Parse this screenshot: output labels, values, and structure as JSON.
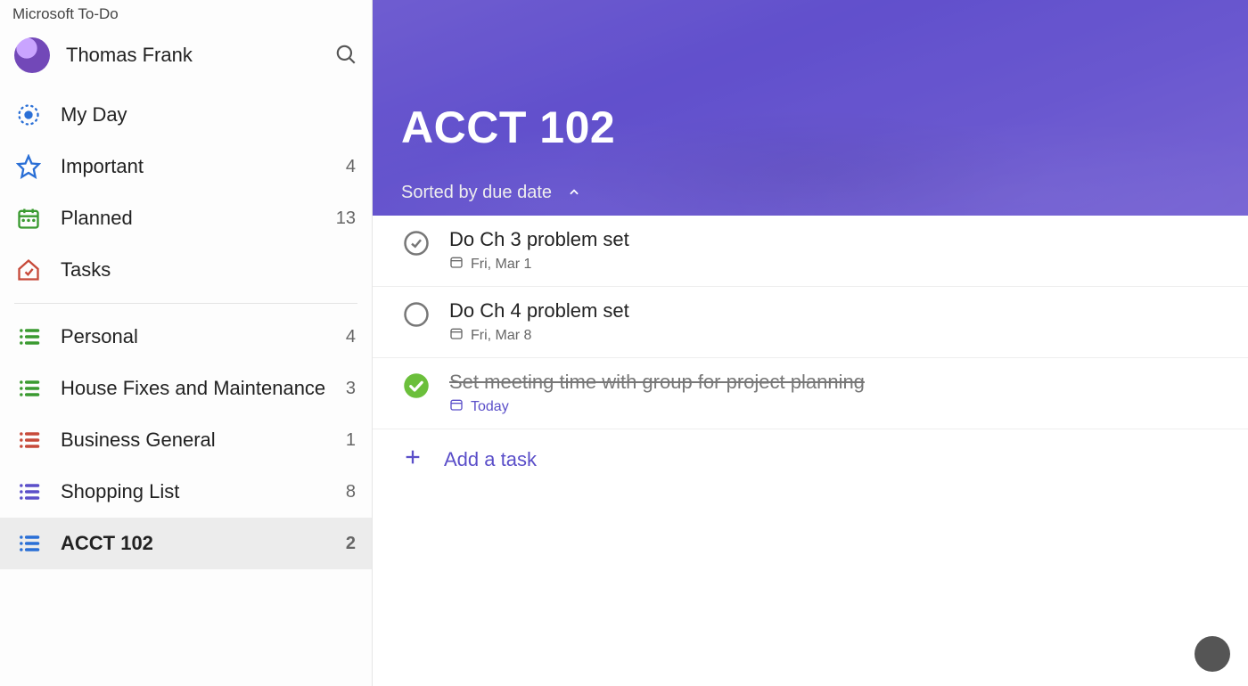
{
  "app": {
    "title": "Microsoft To-Do"
  },
  "profile": {
    "name": "Thomas Frank"
  },
  "colors": {
    "accent": "#5b4fc9",
    "green": "#3a9a30",
    "red": "#c74a3a",
    "blue": "#2a6fd6",
    "sun": "#2a6fd6"
  },
  "sidebar": {
    "smart_lists": [
      {
        "id": "myday",
        "label": "My Day",
        "icon": "sun-icon",
        "color": "#2a6fd6",
        "count": null
      },
      {
        "id": "important",
        "label": "Important",
        "icon": "star-icon",
        "color": "#2a6fd6",
        "count": 4
      },
      {
        "id": "planned",
        "label": "Planned",
        "icon": "calendar-icon",
        "color": "#3a9a30",
        "count": 13
      },
      {
        "id": "tasks",
        "label": "Tasks",
        "icon": "home-check-icon",
        "color": "#c74a3a",
        "count": null
      }
    ],
    "custom_lists": [
      {
        "id": "personal",
        "label": "Personal",
        "color": "#3a9a30",
        "count": 4
      },
      {
        "id": "house",
        "label": "House Fixes and Maintenance",
        "color": "#3a9a30",
        "count": 3
      },
      {
        "id": "business",
        "label": "Business General",
        "color": "#c74a3a",
        "count": 1
      },
      {
        "id": "shopping",
        "label": "Shopping List",
        "color": "#5b4fc9",
        "count": 8
      },
      {
        "id": "acct102",
        "label": "ACCT 102",
        "color": "#2a6fd6",
        "count": 2,
        "active": true
      }
    ]
  },
  "main": {
    "list_title": "ACCT 102",
    "sort_label": "Sorted by due date",
    "add_task_label": "Add a task",
    "tasks": [
      {
        "title": "Do Ch 3 problem set",
        "due": "Fri, Mar 1",
        "completed": false,
        "hover": true,
        "due_today": false
      },
      {
        "title": "Do Ch 4 problem set",
        "due": "Fri, Mar 8",
        "completed": false,
        "hover": false,
        "due_today": false
      },
      {
        "title": "Set meeting time with group for project planning",
        "due": "Today",
        "completed": true,
        "hover": false,
        "due_today": true
      }
    ]
  }
}
